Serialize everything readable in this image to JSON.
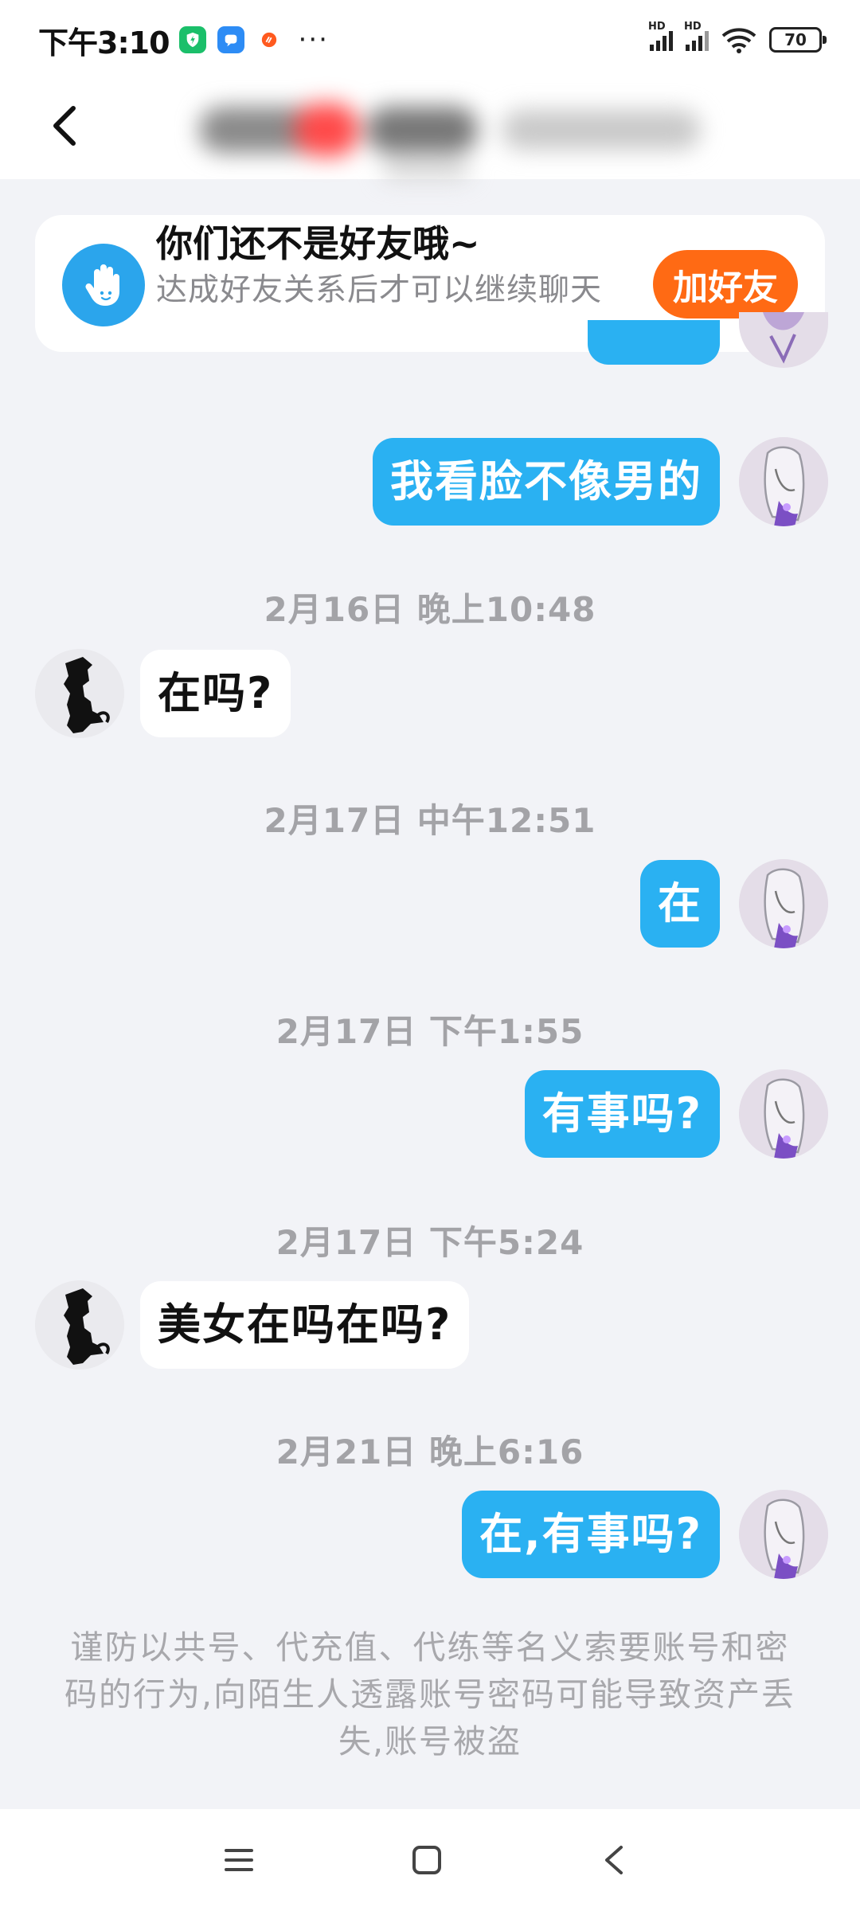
{
  "status_bar": {
    "time": "下午3:10",
    "more": "···",
    "signal_label_1": "HD",
    "signal_label_2": "HD",
    "battery": "70",
    "apps": [
      {
        "icon": "green-shield-app-icon",
        "color": "#1bbf6a"
      },
      {
        "icon": "blue-chat-app-icon",
        "color": "#2d8cf5"
      },
      {
        "icon": "orange-fire-app-icon",
        "color": "#ff5a1f"
      }
    ]
  },
  "header": {
    "back_icon": "chevron-left-icon",
    "title": ""
  },
  "banner": {
    "icon": "waving-hand-icon",
    "title": "你们还不是好友哦~",
    "desc": "达成好友关系后才可以继续聊天",
    "button": "加好友",
    "icon_color": "#2ba5ec",
    "button_color": "#ff6a14"
  },
  "messages": [
    {
      "type": "out",
      "text": "我看脸不像男的"
    },
    {
      "type": "time",
      "text": "2月16日 晚上10:48"
    },
    {
      "type": "in",
      "text": "在吗?"
    },
    {
      "type": "time",
      "text": "2月17日 中午12:51"
    },
    {
      "type": "out",
      "text": "在"
    },
    {
      "type": "time",
      "text": "2月17日 下午1:55"
    },
    {
      "type": "out",
      "text": "有事吗?"
    },
    {
      "type": "time",
      "text": "2月17日 下午5:24"
    },
    {
      "type": "in",
      "text": "美女在吗在吗?"
    },
    {
      "type": "time",
      "text": "2月21日 晚上6:16"
    },
    {
      "type": "out",
      "text": "在,有事吗?"
    }
  ],
  "colors": {
    "outgoing_bubble": "#2ab1f2",
    "incoming_bubble": "#ffffff",
    "background": "#f2f3f7"
  },
  "warning": "谨防以共号、代充值、代练等名义索要账号和密码的行为,向陌生人透露账号密码可能导致资产丢失,账号被盗",
  "nav": {
    "menu_icon": "menu-icon",
    "home_icon": "home-square-icon",
    "back_icon": "back-triangle-icon"
  }
}
